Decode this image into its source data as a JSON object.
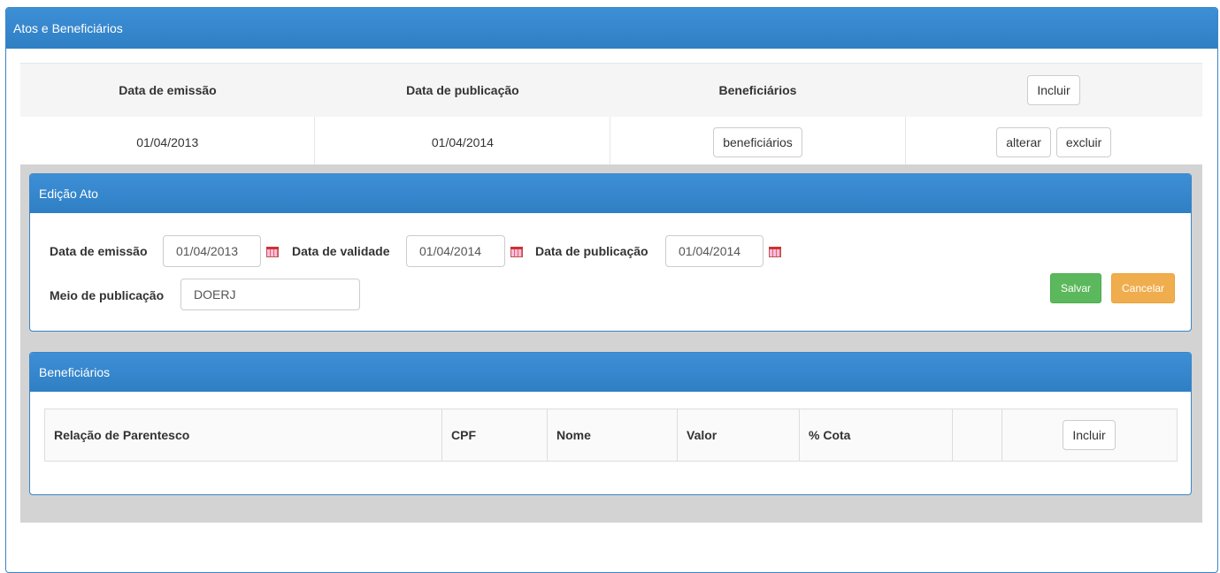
{
  "outer_panel": {
    "title": "Atos e Beneficiários"
  },
  "atos_table": {
    "headers": [
      "Data de emissão",
      "Data de publicação",
      "Beneficiários"
    ],
    "include_label": "Incluir",
    "rows": [
      {
        "emissao": "01/04/2013",
        "publicacao": "01/04/2014",
        "beneficiarios_label": "beneficiários",
        "alterar_label": "alterar",
        "excluir_label": "excluir"
      }
    ]
  },
  "edit_panel": {
    "title": "Edição Ato",
    "fields": {
      "emissao_label": "Data de emissão",
      "emissao_value": "01/04/2013",
      "validade_label": "Data de validade",
      "validade_value": "01/04/2014",
      "publicacao_label": "Data de publicação",
      "publicacao_value": "01/04/2014",
      "meio_label": "Meio de publicação",
      "meio_value": "DOERJ"
    },
    "save_label": "Salvar",
    "cancel_label": "Cancelar",
    "icons": {
      "calendar": "calendar-icon"
    },
    "colors": {
      "save": "#5cb85c",
      "cancel": "#f0ad4e",
      "heading": "#337ab7"
    }
  },
  "ben_panel": {
    "title": "Beneficiários",
    "headers": [
      "Relação de Parentesco",
      "CPF",
      "Nome",
      "Valor",
      "% Cota",
      ""
    ],
    "include_label": "Incluir"
  }
}
